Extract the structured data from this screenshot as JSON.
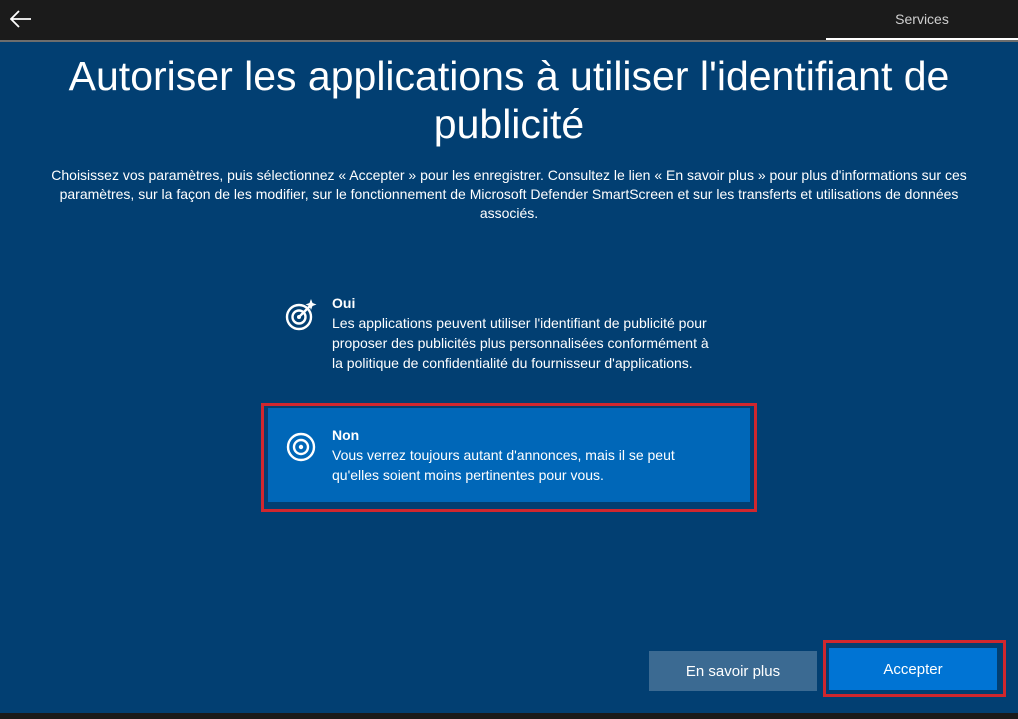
{
  "header": {
    "tab_label": "Services"
  },
  "page": {
    "title": "Autoriser les applications à utiliser l'identifiant de publicité",
    "description": "Choisissez vos paramètres, puis sélectionnez « Accepter » pour les enregistrer. Consultez le lien « En savoir plus » pour plus d'informations sur ces paramètres, sur la façon de les modifier, sur le fonctionnement de Microsoft Defender SmartScreen et sur les transferts et utilisations de données associés."
  },
  "options": [
    {
      "title": "Oui",
      "description": "Les applications peuvent utiliser l'identifiant de publicité pour proposer des publicités plus personnalisées conformément à la politique de confidentialité du fournisseur d'applications.",
      "icon": "target-sparkle-icon",
      "selected": false
    },
    {
      "title": "Non",
      "description": "Vous verrez toujours autant d'annonces, mais il se peut qu'elles soient moins pertinentes pour vous.",
      "icon": "target-icon",
      "selected": true
    }
  ],
  "buttons": {
    "learn_more": "En savoir plus",
    "accept": "Accepter"
  },
  "colors": {
    "background": "#023f72",
    "selected_option": "#0067b8",
    "accept_button": "#0074d4",
    "secondary_button": "#3b6a92",
    "highlight": "#d0272e"
  }
}
